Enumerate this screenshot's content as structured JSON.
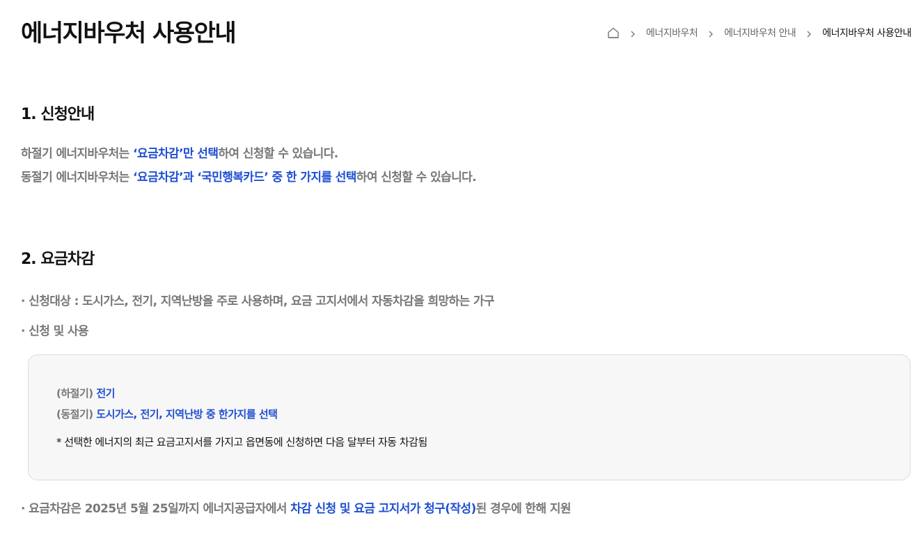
{
  "page": {
    "title": "에너지바우처 사용안내"
  },
  "breadcrumb": {
    "home_icon": "home-icon",
    "items": [
      "에너지바우처",
      "에너지바우처 안내",
      "에너지바우처 사용안내"
    ]
  },
  "section1": {
    "title": "1. 신청안내",
    "line1": {
      "pre": "하절기 에너지바우처는 ",
      "highlight": "‘요금차감’만 선택",
      "post": "하여 신청할 수 있습니다."
    },
    "line2": {
      "pre": "동절기 에너지바우처는 ",
      "highlight": "‘요금차감’과 ‘국민행복카드’ 중 한 가지를 선택",
      "post": "하여 신청할 수 있습니다."
    }
  },
  "section2": {
    "title": "2. 요금차감",
    "bullet1": "· 신청대상 : 도시가스, 전기, 지역난방을 주로 사용하며, 요금 고지서에서 자동차감을 희망하는 가구",
    "bullet2": "· 신청 및 사용",
    "box": {
      "summer_label": "(하절기) ",
      "summer_value": "전기",
      "winter_label": "(동절기) ",
      "winter_value": "도시가스, 전기, 지역난방 중 한가지를 선택",
      "note": "* 선택한 에너지의 최근 요금고지서를 가지고 읍면동에 신청하면 다음 달부터 자동 차감됨"
    },
    "bullet3": {
      "pre": "· 요금차감은 2025년 5월 25일까지 에너지공급자에서 ",
      "highlight": "차감 신청 및 요금 고지서가 청구(작성)",
      "post": "된 경우에 한해 지원"
    }
  },
  "colors": {
    "highlight": "#1f4fd1",
    "muted_text": "#777777",
    "box_background": "#f7f7f7"
  }
}
